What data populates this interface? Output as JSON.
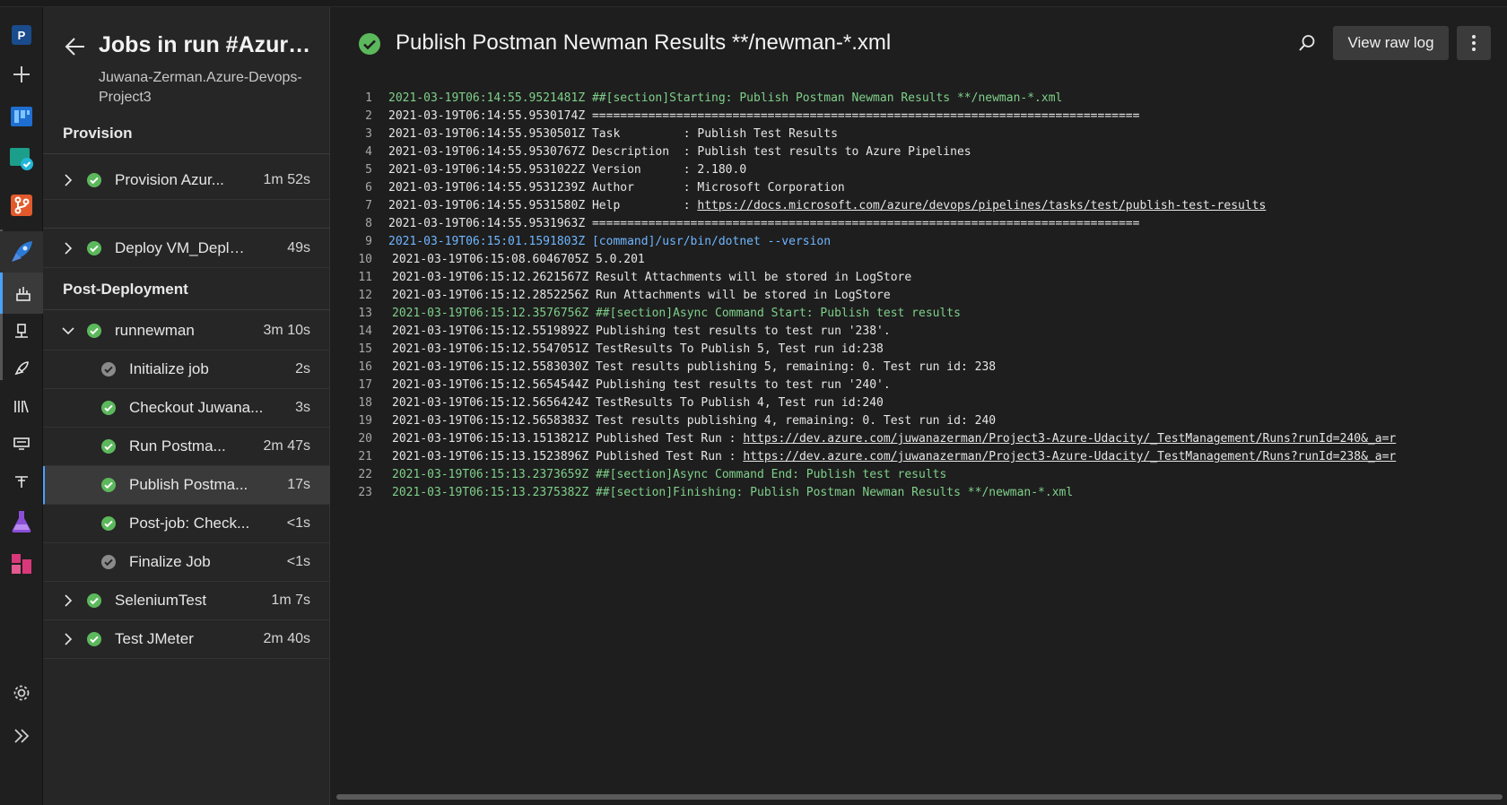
{
  "rail": {
    "org_initial": "P",
    "items": [
      "new",
      "boards",
      "boards-check",
      "repos",
      "pipelines",
      "pipelines-runs",
      "environments",
      "releases",
      "library",
      "task-groups",
      "deployment-groups",
      "test-plans",
      "artifacts",
      "settings",
      "expand"
    ]
  },
  "jobs": {
    "title": "Jobs in run #Azure ...",
    "subtitle": "Juwana-Zerman.Azure-Devops-Project3",
    "stages": [
      {
        "label": "Provision"
      },
      {
        "label": "Post-Deployment"
      }
    ],
    "rows": [
      {
        "name": "Provision Azur...",
        "duration": "1m 52s",
        "status": "success",
        "expander": "collapsed"
      },
      {
        "name": "Deploy VM_Deplo...",
        "duration": "49s",
        "status": "success",
        "expander": "collapsed"
      },
      {
        "name": "runnewman",
        "duration": "3m 10s",
        "status": "success",
        "expander": "expanded"
      },
      {
        "name": "Initialize job",
        "duration": "2s",
        "status": "skipped-gray"
      },
      {
        "name": "Checkout Juwana...",
        "duration": "3s",
        "status": "success"
      },
      {
        "name": "Run Postma...",
        "duration": "2m 47s",
        "status": "success"
      },
      {
        "name": "Publish Postma...",
        "duration": "17s",
        "status": "success",
        "selected": true
      },
      {
        "name": "Post-job: Check...",
        "duration": "<1s",
        "status": "success"
      },
      {
        "name": "Finalize Job",
        "duration": "<1s",
        "status": "skipped-gray"
      },
      {
        "name": "SeleniumTest",
        "duration": "1m 7s",
        "status": "success",
        "expander": "collapsed"
      },
      {
        "name": "Test JMeter",
        "duration": "2m 40s",
        "status": "success",
        "expander": "collapsed"
      }
    ]
  },
  "main": {
    "title": "Publish Postman Newman Results **/newman-*.xml",
    "view_raw_label": "View raw log",
    "search_icon": "search-icon",
    "more_icon": "more-vertical-icon"
  },
  "colors": {
    "success": "#5cb85c",
    "section_text": "#7fd08a",
    "command_text": "#6fb6ff",
    "accent": "#4aa0ff"
  },
  "log": [
    {
      "n": "1",
      "kind": "section",
      "text": "2021-03-19T06:14:55.9521481Z ##[section]Starting: Publish Postman Newman Results **/newman-*.xml"
    },
    {
      "n": "2",
      "kind": "plain",
      "text": "2021-03-19T06:14:55.9530174Z =============================================================================="
    },
    {
      "n": "3",
      "kind": "plain",
      "text": "2021-03-19T06:14:55.9530501Z Task         : Publish Test Results"
    },
    {
      "n": "4",
      "kind": "plain",
      "text": "2021-03-19T06:14:55.9530767Z Description  : Publish test results to Azure Pipelines"
    },
    {
      "n": "5",
      "kind": "plain",
      "text": "2021-03-19T06:14:55.9531022Z Version      : 2.180.0"
    },
    {
      "n": "6",
      "kind": "plain",
      "text": "2021-03-19T06:14:55.9531239Z Author       : Microsoft Corporation"
    },
    {
      "n": "7",
      "kind": "link",
      "text": "2021-03-19T06:14:55.9531580Z Help         : ",
      "link": "https://docs.microsoft.com/azure/devops/pipelines/tasks/test/publish-test-results"
    },
    {
      "n": "8",
      "kind": "plain",
      "text": "2021-03-19T06:14:55.9531963Z =============================================================================="
    },
    {
      "n": "9",
      "kind": "command",
      "text": "2021-03-19T06:15:01.1591803Z [command]/usr/bin/dotnet --version"
    },
    {
      "n": "10",
      "kind": "plain-ind",
      "text": "2021-03-19T06:15:08.6046705Z 5.0.201"
    },
    {
      "n": "11",
      "kind": "plain-ind",
      "text": "2021-03-19T06:15:12.2621567Z Result Attachments will be stored in LogStore"
    },
    {
      "n": "12",
      "kind": "plain-ind",
      "text": "2021-03-19T06:15:12.2852256Z Run Attachments will be stored in LogStore"
    },
    {
      "n": "13",
      "kind": "section-ind",
      "text": "2021-03-19T06:15:12.3576756Z ##[section]Async Command Start: Publish test results"
    },
    {
      "n": "14",
      "kind": "plain-ind",
      "text": "2021-03-19T06:15:12.5519892Z Publishing test results to test run '238'."
    },
    {
      "n": "15",
      "kind": "plain-ind",
      "text": "2021-03-19T06:15:12.5547051Z TestResults To Publish 5, Test run id:238"
    },
    {
      "n": "16",
      "kind": "plain-ind",
      "text": "2021-03-19T06:15:12.5583030Z Test results publishing 5, remaining: 0. Test run id: 238"
    },
    {
      "n": "17",
      "kind": "plain-ind",
      "text": "2021-03-19T06:15:12.5654544Z Publishing test results to test run '240'."
    },
    {
      "n": "18",
      "kind": "plain-ind",
      "text": "2021-03-19T06:15:12.5656424Z TestResults To Publish 4, Test run id:240"
    },
    {
      "n": "19",
      "kind": "plain-ind",
      "text": "2021-03-19T06:15:12.5658383Z Test results publishing 4, remaining: 0. Test run id: 240"
    },
    {
      "n": "20",
      "kind": "link-ind",
      "text": "2021-03-19T06:15:13.1513821Z Published Test Run : ",
      "link": "https://dev.azure.com/juwanazerman/Project3-Azure-Udacity/_TestManagement/Runs?runId=240&_a=r"
    },
    {
      "n": "21",
      "kind": "link-ind",
      "text": "2021-03-19T06:15:13.1523896Z Published Test Run : ",
      "link": "https://dev.azure.com/juwanazerman/Project3-Azure-Udacity/_TestManagement/Runs?runId=238&_a=r"
    },
    {
      "n": "22",
      "kind": "section-ind",
      "text": "2021-03-19T06:15:13.2373659Z ##[section]Async Command End: Publish test results"
    },
    {
      "n": "23",
      "kind": "section-ind",
      "text": "2021-03-19T06:15:13.2375382Z ##[section]Finishing: Publish Postman Newman Results **/newman-*.xml"
    }
  ]
}
